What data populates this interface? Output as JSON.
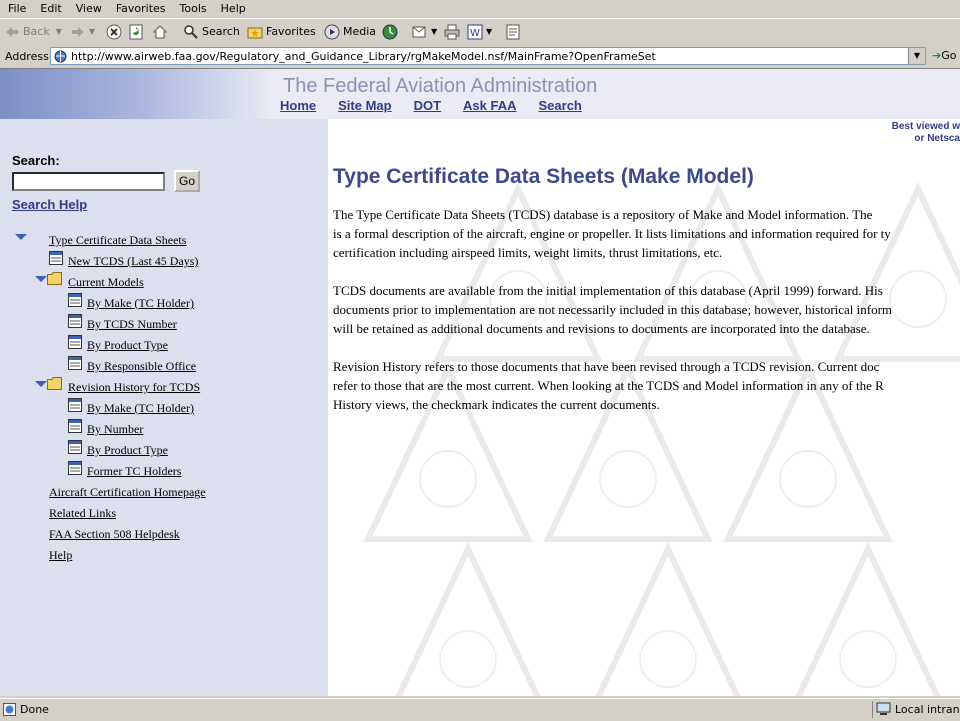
{
  "menu": [
    "File",
    "Edit",
    "View",
    "Favorites",
    "Tools",
    "Help"
  ],
  "toolbar": {
    "back": "Back",
    "search": "Search",
    "favorites": "Favorites",
    "media": "Media"
  },
  "address": {
    "label": "Address",
    "url": "http://www.airweb.faa.gov/Regulatory_and_Guidance_Library/rgMakeModel.nsf/MainFrame?OpenFrameSet",
    "go": "Go"
  },
  "banner": {
    "title": "The Federal Aviation Administration",
    "nav": [
      "Home",
      "Site Map",
      "DOT",
      "Ask FAA",
      "Search"
    ]
  },
  "sidebar": {
    "search_label": "Search:",
    "go_label": "Go",
    "search_help": "Search Help",
    "tree": {
      "root": "Type Certificate Data Sheets",
      "new_tcds": "New TCDS (Last 45 Days)",
      "current_models": "Current Models",
      "current_items": [
        "By Make (TC Holder)",
        "By TCDS Number",
        "By Product Type",
        "By Responsible Office"
      ],
      "revision_history": "Revision History for TCDS",
      "revision_items": [
        "By Make (TC Holder)",
        "By Number",
        "By Product Type",
        "Former TC Holders"
      ]
    },
    "links": [
      "Aircraft Certification Homepage",
      "Related Links",
      "FAA Section 508 Helpdesk",
      "Help"
    ]
  },
  "main": {
    "best_viewed_1": "Best viewed w",
    "best_viewed_2": "or Netsca",
    "title": "Type Certificate Data Sheets (Make Model)",
    "para1": [
      "The Type Certificate Data Sheets (TCDS) database is a repository of Make and Model information. The",
      "is a formal description of the aircraft, engine or propeller. It lists limitations and information required for ty",
      "certification including airspeed limits, weight limits, thrust limitations, etc."
    ],
    "para2": [
      "TCDS documents are available from the initial implementation of this database (April 1999) forward. His",
      "documents prior to implementation are not necessarily included in this database; however, historical inform",
      "will be retained as additional documents and revisions to documents are incorporated into the database."
    ],
    "para3": [
      "Revision History refers to those documents that have been revised through a TCDS revision. Current doc",
      "refer to those that are the most current. When looking at the TCDS and Model information in any of the R",
      "History views, the checkmark indicates the current documents."
    ]
  },
  "status": {
    "text": "Done",
    "zone": "Local intranet"
  }
}
